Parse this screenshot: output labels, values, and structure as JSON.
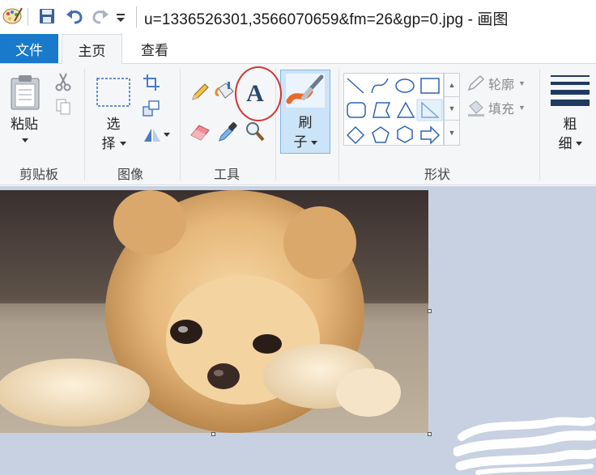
{
  "titlebar": {
    "title": "u=1336526301,3566070659&fm=26&gp=0.jpg - 画图"
  },
  "tabs": {
    "file": "文件",
    "home": "主页",
    "view": "查看"
  },
  "clipboard": {
    "paste_label_1": "粘贴",
    "group_label": "剪贴板"
  },
  "image": {
    "select_label_1": "选",
    "select_label_2": "择",
    "group_label": "图像"
  },
  "tools": {
    "group_label": "工具",
    "text_tool_glyph": "A"
  },
  "brushes": {
    "label_1": "刷",
    "label_2": "子"
  },
  "shapes": {
    "outline_label": "轮廓",
    "fill_label": "填充",
    "group_label": "形状"
  },
  "size": {
    "label_1": "粗",
    "label_2": "细"
  },
  "colors": {
    "accent": "#1979ca",
    "ribbon_bg": "#f5f6f7",
    "workspace_bg": "#c8d1e2",
    "highlight_circle": "#d2342f"
  }
}
